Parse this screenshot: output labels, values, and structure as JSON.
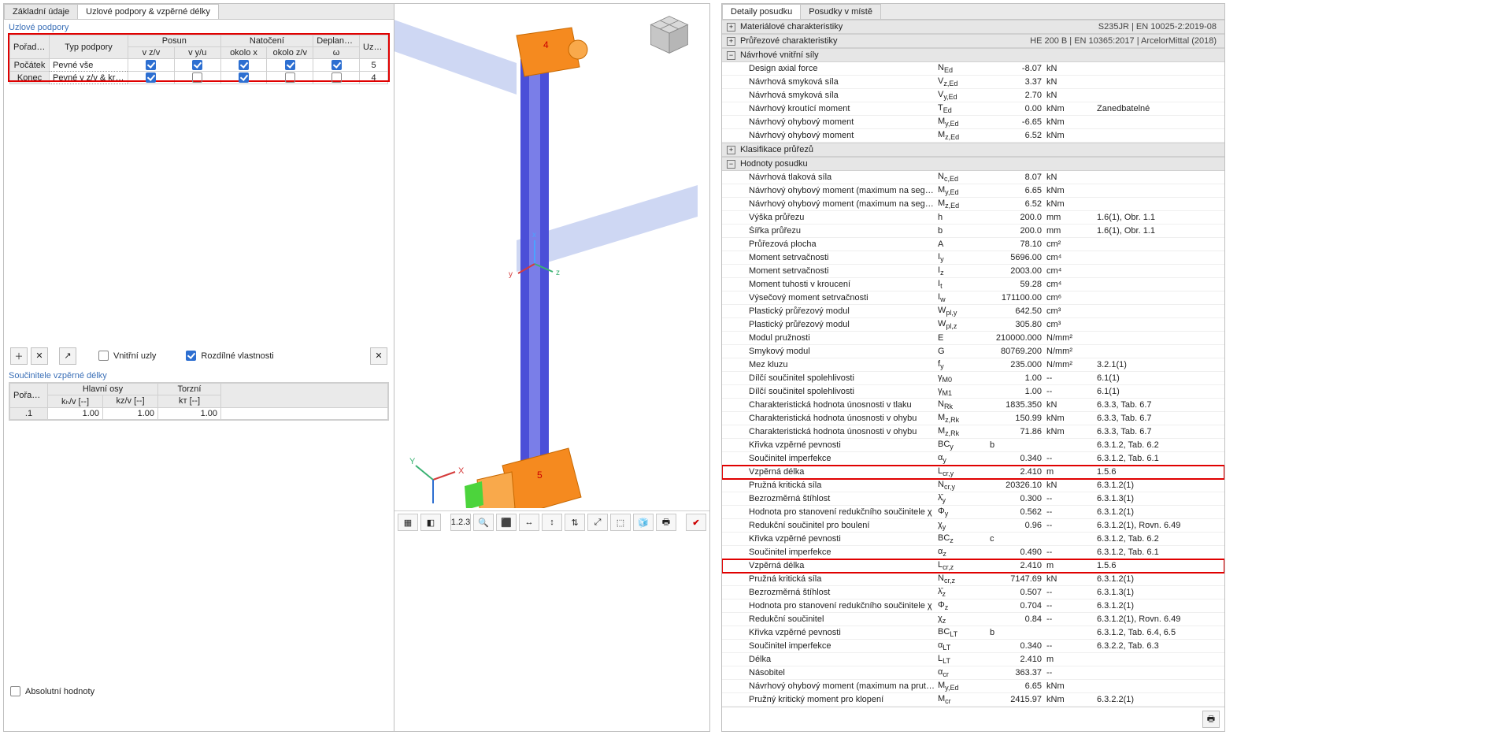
{
  "left_tabs": [
    "Základní údaje",
    "Uzlové podpory & vzpěrné délky"
  ],
  "left_active_tab": 1,
  "podpory": {
    "title": "Uzlové podpory",
    "h1": "Pořadí uzlů",
    "h2": "Typ podpory",
    "hPosun": "Posun",
    "hNat": "Natočení",
    "hDep": "Deplanace",
    "hUzel": "Uzel č.",
    "sub": [
      "v z/v",
      "v y/u",
      "okolo x",
      "okolo z/v",
      "ω"
    ],
    "rows": [
      {
        "lbl": "Počátek",
        "typ": "Pevné vše",
        "c": [
          true,
          true,
          true,
          true,
          true
        ],
        "uzel": "5"
      },
      {
        "lbl": "Konec",
        "typ": "Pevné v z/v & krouc…",
        "c": [
          true,
          false,
          true,
          false,
          false
        ],
        "uzel": "4"
      }
    ],
    "vnitrni": "Vnitřní uzly",
    "rozdilne": "Rozdílné vlastnosti"
  },
  "soucinitele": {
    "title": "Součinitele vzpěrné délky",
    "h1": "Pořadí segm. č.",
    "hHlavni": "Hlavní osy",
    "hTorzni": "Torzní",
    "sub": [
      "kₕ/v [--]",
      "kᴢ/v [--]",
      "kᴛ [--]"
    ],
    "rows": [
      {
        "seg": ".1",
        "ky": "1.00",
        "kz": "1.00",
        "kt": "1.00"
      }
    ],
    "abs": "Absolutní hodnoty"
  },
  "right_tabs": [
    "Detaily posudku",
    "Posudky v místě"
  ],
  "right_active_tab": 0,
  "right_header": [
    "S235JR | EN 10025-2:2019-08",
    "HE 200 B | EN 10365:2017 | ArcelorMittal (2018)"
  ],
  "sections": [
    {
      "t": "Materiálové charakteristiky",
      "collapsed": true
    },
    {
      "t": "Průřezové charakteristiky",
      "collapsed": true
    },
    {
      "t": "Návrhové vnitřní síly",
      "rows": [
        {
          "l": "Design axial force",
          "s": "N_Ed",
          "v": "-8.07",
          "u": "kN",
          "r": ""
        },
        {
          "l": "Návrhová smyková síla",
          "s": "V_z,Ed",
          "v": "3.37",
          "u": "kN",
          "r": ""
        },
        {
          "l": "Návrhová smyková síla",
          "s": "V_y,Ed",
          "v": "2.70",
          "u": "kN",
          "r": ""
        },
        {
          "l": "Návrhový kroutící moment",
          "s": "T_Ed",
          "v": "0.00",
          "u": "kNm",
          "r": "Zanedbatelné"
        },
        {
          "l": "Návrhový ohybový moment",
          "s": "M_y,Ed",
          "v": "-6.65",
          "u": "kNm",
          "r": ""
        },
        {
          "l": "Návrhový ohybový moment",
          "s": "M_z,Ed",
          "v": "6.52",
          "u": "kNm",
          "r": ""
        }
      ]
    },
    {
      "t": "Klasifikace průřezů",
      "collapsed": true
    },
    {
      "t": "Hodnoty posudku",
      "rows": [
        {
          "l": "Návrhová tlaková síla",
          "s": "N_c,Ed",
          "v": "8.07",
          "u": "kN",
          "r": ""
        },
        {
          "l": "Návrhový ohybový moment (maximum na segmentu)",
          "s": "M_y,Ed",
          "v": "6.65",
          "u": "kNm",
          "r": ""
        },
        {
          "l": "Návrhový ohybový moment (maximum na segmentu)",
          "s": "M_z,Ed",
          "v": "6.52",
          "u": "kNm",
          "r": ""
        },
        {
          "l": "Výška průřezu",
          "s": "h",
          "v": "200.0",
          "u": "mm",
          "r": "1.6(1), Obr. 1.1"
        },
        {
          "l": "Šířka průřezu",
          "s": "b",
          "v": "200.0",
          "u": "mm",
          "r": "1.6(1), Obr. 1.1"
        },
        {
          "l": "Průřezová plocha",
          "s": "A",
          "v": "78.10",
          "u": "cm²",
          "r": ""
        },
        {
          "l": "Moment setrvačnosti",
          "s": "I_y",
          "v": "5696.00",
          "u": "cm⁴",
          "r": ""
        },
        {
          "l": "Moment setrvačnosti",
          "s": "I_z",
          "v": "2003.00",
          "u": "cm⁴",
          "r": ""
        },
        {
          "l": "Moment tuhosti v kroucení",
          "s": "I_t",
          "v": "59.28",
          "u": "cm⁴",
          "r": ""
        },
        {
          "l": "Výsečový moment setrvačnosti",
          "s": "I_w",
          "v": "171100.00",
          "u": "cm⁶",
          "r": ""
        },
        {
          "l": "Plastický průřezový modul",
          "s": "W_pl,y",
          "v": "642.50",
          "u": "cm³",
          "r": ""
        },
        {
          "l": "Plastický průřezový modul",
          "s": "W_pl,z",
          "v": "305.80",
          "u": "cm³",
          "r": ""
        },
        {
          "l": "Modul pružnosti",
          "s": "E",
          "v": "210000.000",
          "u": "N/mm²",
          "r": ""
        },
        {
          "l": "Smykový modul",
          "s": "G",
          "v": "80769.200",
          "u": "N/mm²",
          "r": ""
        },
        {
          "l": "Mez kluzu",
          "s": "f_y",
          "v": "235.000",
          "u": "N/mm²",
          "r": "3.2.1(1)"
        },
        {
          "l": "Dílčí součinitel spolehlivosti",
          "s": "γ_M0",
          "v": "1.00",
          "u": "--",
          "r": "6.1(1)"
        },
        {
          "l": "Dílčí součinitel spolehlivosti",
          "s": "γ_M1",
          "v": "1.00",
          "u": "--",
          "r": "6.1(1)"
        },
        {
          "l": "Charakteristická hodnota únosnosti v tlaku",
          "s": "N_Rk",
          "v": "1835.350",
          "u": "kN",
          "r": "6.3.3, Tab. 6.7"
        },
        {
          "l": "Charakteristická hodnota únosnosti v ohybu",
          "s": "M_z,Rk",
          "v": "150.99",
          "u": "kNm",
          "r": "6.3.3, Tab. 6.7"
        },
        {
          "l": "Charakteristická hodnota únosnosti v ohybu",
          "s": "M_z,Rk",
          "v": "71.86",
          "u": "kNm",
          "r": "6.3.3, Tab. 6.7"
        },
        {
          "l": "Křivka vzpěrné pevnosti",
          "s": "BC_y",
          "v": "b",
          "u": "",
          "r": "6.3.1.2, Tab. 6.2",
          "txt": true
        },
        {
          "l": "Součinitel imperfekce",
          "s": "α_y",
          "v": "0.340",
          "u": "--",
          "r": "6.3.1.2, Tab. 6.1"
        },
        {
          "l": "Vzpěrná délka",
          "s": "L_cr,y",
          "v": "2.410",
          "u": "m",
          "r": "1.5.6",
          "hl": true
        },
        {
          "l": "Pružná kritická síla",
          "s": "N_cr,y",
          "v": "20326.10",
          "u": "kN",
          "r": "6.3.1.2(1)"
        },
        {
          "l": "Bezrozměrná štíhlost",
          "s": "λ̄_y",
          "v": "0.300",
          "u": "--",
          "r": "6.3.1.3(1)"
        },
        {
          "l": "Hodnota pro stanovení redukčního součinitele χ",
          "s": "Φ_y",
          "v": "0.562",
          "u": "--",
          "r": "6.3.1.2(1)"
        },
        {
          "l": "Redukční součinitel pro boulení",
          "s": "χ_y",
          "v": "0.96",
          "u": "--",
          "r": "6.3.1.2(1), Rovn. 6.49"
        },
        {
          "l": "Křivka vzpěrné pevnosti",
          "s": "BC_z",
          "v": "c",
          "u": "",
          "r": "6.3.1.2, Tab. 6.2",
          "txt": true
        },
        {
          "l": "Součinitel imperfekce",
          "s": "α_z",
          "v": "0.490",
          "u": "--",
          "r": "6.3.1.2, Tab. 6.1"
        },
        {
          "l": "Vzpěrná délka",
          "s": "L_cr,z",
          "v": "2.410",
          "u": "m",
          "r": "1.5.6",
          "hl": true
        },
        {
          "l": "Pružná kritická síla",
          "s": "N_cr,z",
          "v": "7147.69",
          "u": "kN",
          "r": "6.3.1.2(1)"
        },
        {
          "l": "Bezrozměrná štíhlost",
          "s": "λ̄_z",
          "v": "0.507",
          "u": "--",
          "r": "6.3.1.3(1)"
        },
        {
          "l": "Hodnota pro stanovení redukčního součinitele χ",
          "s": "Φ_z",
          "v": "0.704",
          "u": "--",
          "r": "6.3.1.2(1)"
        },
        {
          "l": "Redukční součinitel",
          "s": "χ_z",
          "v": "0.84",
          "u": "--",
          "r": "6.3.1.2(1), Rovn. 6.49"
        },
        {
          "l": "Křivka vzpěrné pevnosti",
          "s": "BC_LT",
          "v": "b",
          "u": "",
          "r": "6.3.1.2, Tab. 6.4, 6.5",
          "txt": true
        },
        {
          "l": "Součinitel imperfekce",
          "s": "α_LT",
          "v": "0.340",
          "u": "--",
          "r": "6.3.2.2, Tab. 6.3"
        },
        {
          "l": "Délka",
          "s": "L_LT",
          "v": "2.410",
          "u": "m",
          "r": ""
        },
        {
          "l": "Násobitel",
          "s": "α_cr",
          "v": "363.37",
          "u": "--",
          "r": ""
        },
        {
          "l": "Návrhový ohybový moment (maximum na prutu nebo s…",
          "s": "M_y,Ed",
          "v": "6.65",
          "u": "kNm",
          "r": ""
        },
        {
          "l": "Pružný kritický moment pro klopení",
          "s": "M_cr",
          "v": "2415.97",
          "u": "kNm",
          "r": "6.3.2.2(1)"
        }
      ]
    }
  ]
}
